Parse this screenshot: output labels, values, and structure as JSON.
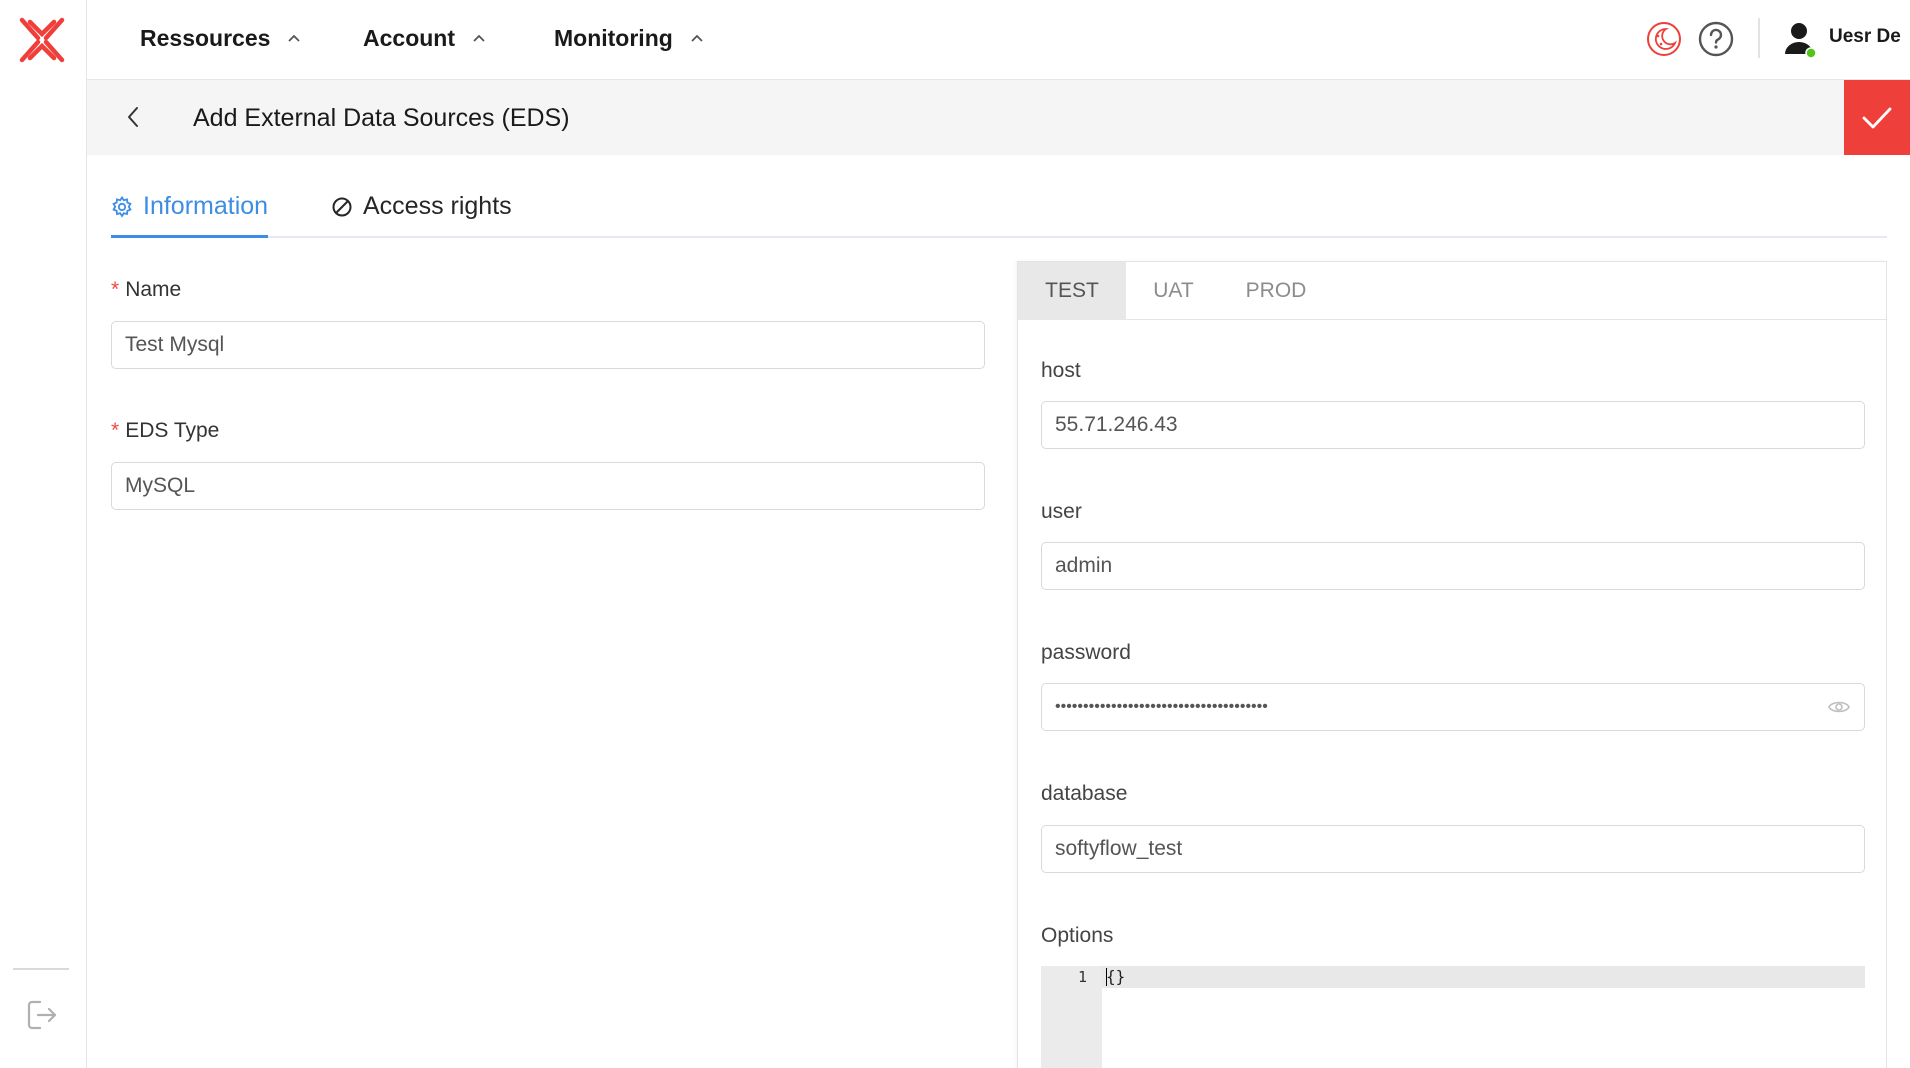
{
  "nav": {
    "items": [
      {
        "label": "Ressources"
      },
      {
        "label": "Account"
      },
      {
        "label": "Monitoring"
      }
    ]
  },
  "user": {
    "name": "Uesr De",
    "status_color": "#52c41a"
  },
  "header": {
    "title": "Add External Data Sources (EDS)"
  },
  "tabs": [
    {
      "label": "Information",
      "icon": "gear-icon",
      "active": true
    },
    {
      "label": "Access rights",
      "icon": "block-icon",
      "active": false
    }
  ],
  "form": {
    "name": {
      "required_mark": "*",
      "label": "Name",
      "value": "Test Mysql"
    },
    "eds_type": {
      "required_mark": "*",
      "label": "EDS Type",
      "value": "MySQL"
    }
  },
  "env": {
    "tabs": [
      {
        "label": "TEST",
        "active": true
      },
      {
        "label": "UAT",
        "active": false
      },
      {
        "label": "PROD",
        "active": false
      }
    ],
    "host": {
      "label": "host",
      "value": "55.71.246.43"
    },
    "user": {
      "label": "user",
      "value": "admin"
    },
    "password": {
      "label": "password",
      "value": "••••••••••••••••••••••••••••••••••••••"
    },
    "database": {
      "label": "database",
      "value": "softyflow_test"
    },
    "options": {
      "label": "Options",
      "line_number": "1",
      "code": "{}"
    }
  },
  "colors": {
    "accent": "#3d8de5",
    "brand": "#ef3f3a",
    "required": "#ef4b45"
  }
}
